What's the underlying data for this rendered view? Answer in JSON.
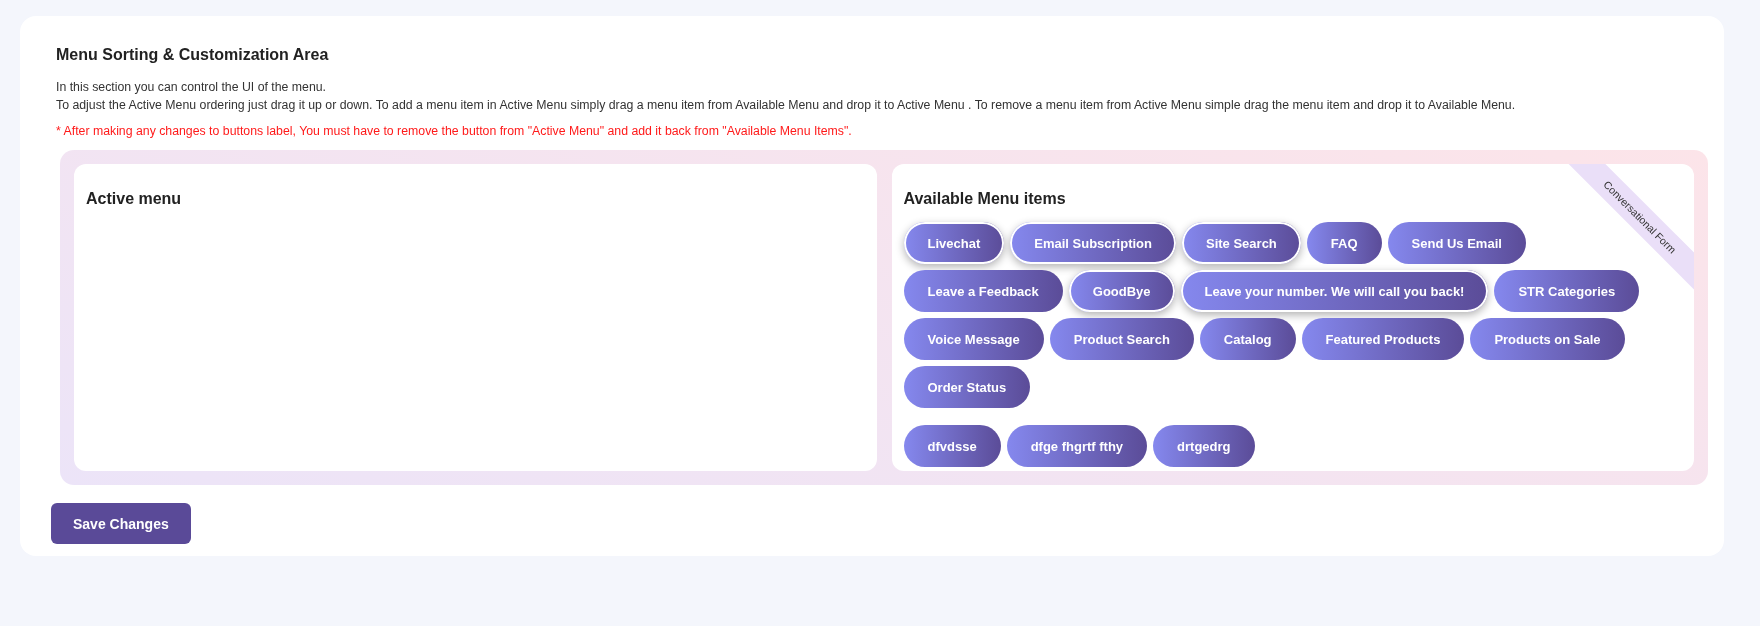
{
  "title": "Menu Sorting & Customization Area",
  "description": [
    "In this section you can control the UI of the menu.",
    "To adjust the Active Menu ordering just drag it up or down. To add a menu item in Active Menu simply drag a menu item from Available Menu and drop it to Active Menu . To remove a menu item from Active Menu simple drag the menu item and drop it to Available Menu."
  ],
  "warning": "* After making any changes to buttons label, You must have to remove the button from \"Active Menu\" and add it back from \"Available Menu Items\".",
  "active_menu": {
    "heading": "Active menu"
  },
  "available_menu": {
    "heading": "Available Menu items",
    "ribbon": "Conversational Form",
    "groups": [
      [
        {
          "label": "Livechat",
          "raised": true
        },
        {
          "label": "Email Subscription",
          "raised": true
        },
        {
          "label": "Site Search",
          "raised": true
        },
        {
          "label": "FAQ",
          "raised": false
        },
        {
          "label": "Send Us Email",
          "raised": false
        },
        {
          "label": "Leave a Feedback",
          "raised": false
        },
        {
          "label": "GoodBye",
          "raised": true
        },
        {
          "label": "Leave your number. We will call you back!",
          "raised": true
        },
        {
          "label": "STR Categories",
          "raised": false
        },
        {
          "label": "Voice Message",
          "raised": false
        },
        {
          "label": "Product Search",
          "raised": false
        },
        {
          "label": "Catalog",
          "raised": false
        },
        {
          "label": "Featured Products",
          "raised": false
        },
        {
          "label": "Products on Sale",
          "raised": false
        },
        {
          "label": "Order Status",
          "raised": false
        }
      ],
      [
        {
          "label": "dfvdsse",
          "raised": false
        },
        {
          "label": "dfge fhgrtf fthy",
          "raised": false
        },
        {
          "label": "drtgedrg",
          "raised": false
        }
      ]
    ]
  },
  "save_button": "Save Changes"
}
